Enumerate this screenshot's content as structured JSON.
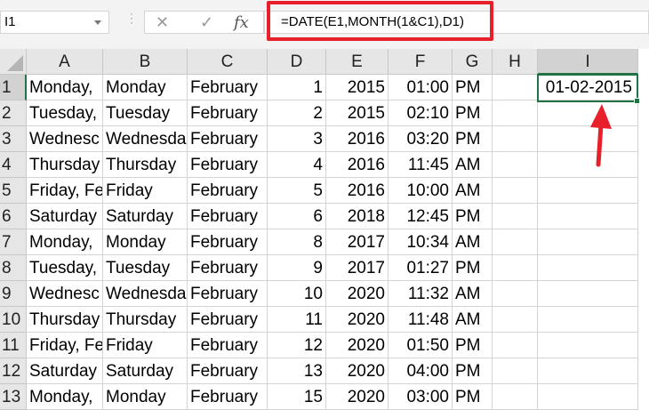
{
  "name_box": "I1",
  "formula": "=DATE(E1,MONTH(1&C1),D1)",
  "icons": {
    "cancel": "✕",
    "enter": "✓",
    "fx": "fx"
  },
  "columns": [
    "A",
    "B",
    "C",
    "D",
    "E",
    "F",
    "G",
    "H",
    "I"
  ],
  "rows": [
    [
      "1",
      "Monday,",
      "Monday",
      "February",
      "1",
      "2015",
      "01:00",
      "PM",
      "",
      "01-02-2015"
    ],
    [
      "2",
      "Tuesday,",
      "Tuesday",
      "February",
      "2",
      "2015",
      "02:10",
      "PM",
      "",
      ""
    ],
    [
      "3",
      "Wednesc",
      "Wednesda",
      "February",
      "3",
      "2016",
      "03:20",
      "PM",
      "",
      ""
    ],
    [
      "4",
      "Thursday",
      "Thursday",
      "February",
      "4",
      "2016",
      "11:45",
      "AM",
      "",
      ""
    ],
    [
      "5",
      "Friday, Fe",
      "Friday",
      "February",
      "5",
      "2016",
      "10:00",
      "AM",
      "",
      ""
    ],
    [
      "6",
      "Saturday",
      "Saturday",
      "February",
      "6",
      "2018",
      "12:45",
      "PM",
      "",
      ""
    ],
    [
      "7",
      "Monday,",
      "Monday",
      "February",
      "8",
      "2017",
      "10:34",
      "AM",
      "",
      ""
    ],
    [
      "8",
      "Tuesday,",
      "Tuesday",
      "February",
      "9",
      "2017",
      "01:27",
      "PM",
      "",
      ""
    ],
    [
      "9",
      "Wednesc",
      "Wednesda",
      "February",
      "10",
      "2020",
      "11:32",
      "AM",
      "",
      ""
    ],
    [
      "10",
      "Thursday",
      "Thursday",
      "February",
      "11",
      "2020",
      "11:48",
      "AM",
      "",
      ""
    ],
    [
      "11",
      "Friday, Fe",
      "Friday",
      "February",
      "12",
      "2020",
      "01:50",
      "PM",
      "",
      ""
    ],
    [
      "12",
      "Saturday",
      "Saturday",
      "February",
      "13",
      "2020",
      "04:00",
      "PM",
      "",
      ""
    ],
    [
      "13",
      "Monday,",
      "Monday",
      "February",
      "15",
      "2020",
      "03:00",
      "PM",
      "",
      ""
    ]
  ],
  "colors": {
    "accent": "#217346",
    "highlight": "#e8202a"
  }
}
